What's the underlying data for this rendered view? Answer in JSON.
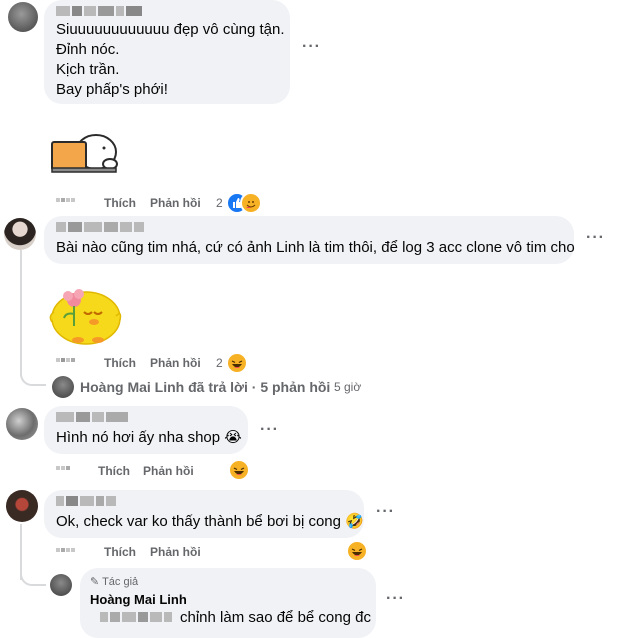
{
  "actions": {
    "like": "Thích",
    "reply": "Phản hồi"
  },
  "comment1": {
    "lines": [
      "Siuuuuuuuuuuuu đẹp vô cùng tận.",
      "Đỉnh nóc.",
      "Kịch trần.",
      "Bay phấp's phới!"
    ],
    "reaction_count": "2",
    "reaction_icons": [
      "like-icon",
      "care-icon"
    ]
  },
  "comment2": {
    "text": "Bài nào cũng tim nhá, cứ có ảnh Linh là tim thôi, để log 3 acc clone vô tim cho",
    "reaction_count": "2",
    "reaction_icons": [
      "haha-icon"
    ],
    "replies_summary": {
      "author": "Hoàng Mai Linh",
      "verb": "đã trả lời",
      "sep": "·",
      "count": "5 phản hồi",
      "time": "5 giờ"
    }
  },
  "comment3": {
    "text": "Hình nó hơi ấy nha shop 😭",
    "reaction_icons": [
      "haha-icon"
    ]
  },
  "comment4": {
    "text": "Ok, check var ko thấy thành bể bơi bị cong 🤣",
    "reaction_icons": [
      "haha-icon"
    ]
  },
  "reply1": {
    "badge": "Tác giả",
    "author": "Hoàng Mai Linh",
    "text": "chỉnh làm sao để bể cong đc"
  },
  "colors": {
    "bubble": "#f0f2f5",
    "meta": "#65676b",
    "like_blue": "#1877f2",
    "haha_yellow": "#f7b125"
  }
}
